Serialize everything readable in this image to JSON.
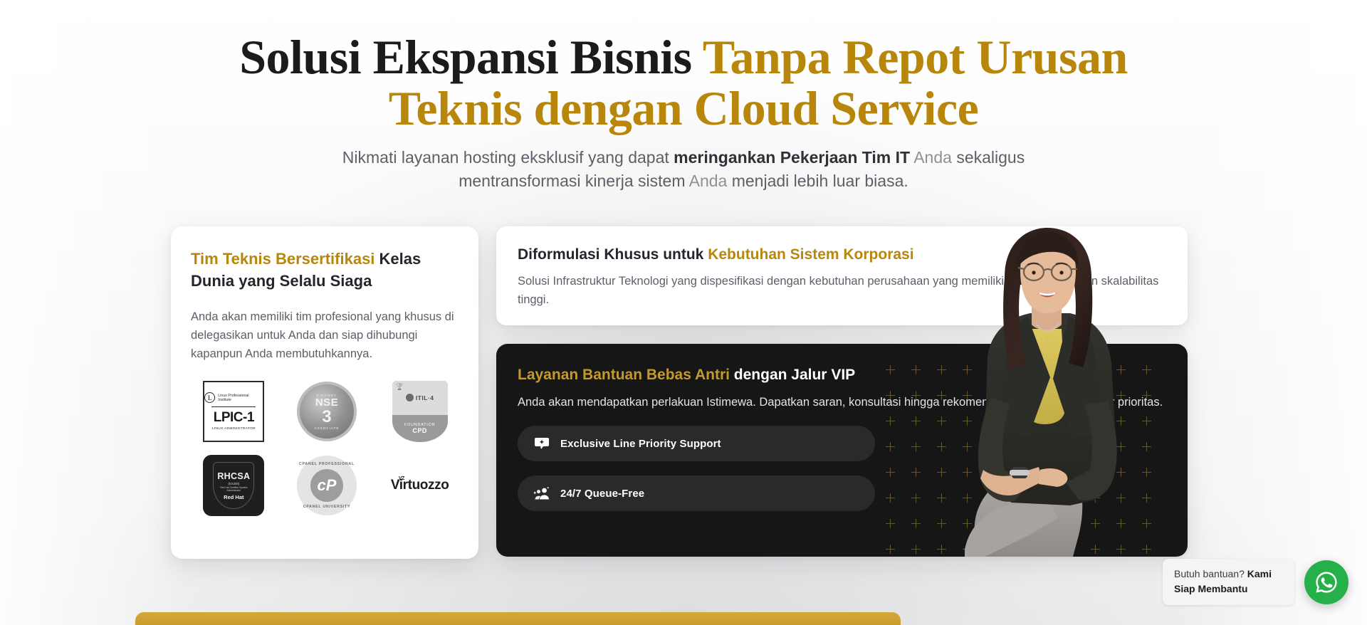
{
  "hero": {
    "headline_part1": "Solusi Ekspansi Bisnis ",
    "headline_part2": "Tanpa Repot Urusan Teknis dengan Cloud Service",
    "sub_1a": "Nikmati layanan hosting eksklusif yang dapat ",
    "sub_1b": "meringankan Pekerjaan Tim IT",
    "sub_1c": " Anda",
    "sub_1d": " sekaligus",
    "sub_2a": "mentransformasi kinerja sistem ",
    "sub_2b": "Anda",
    "sub_2c": " menjadi lebih luar biasa."
  },
  "left_card": {
    "title_gold": "Tim Teknis Bersertifikasi",
    "title_dark": " Kelas Dunia yang Selalu Siaga",
    "body": "Anda akan memiliki tim profesional yang khusus di delegasikan untuk Anda dan siap dihubungi kapanpun Anda membutuhkannya.",
    "badges": [
      {
        "name": "lpic-1",
        "org": "Linux Professional Institute",
        "title": "LPIC-1",
        "subtitle": "LINUX ADMINISTRATOR"
      },
      {
        "name": "fortinet-nse-3",
        "brand": "F RTINET",
        "title": "NSE",
        "level": "3",
        "subtitle": "ASSOCIATE"
      },
      {
        "name": "itil-4-foundation",
        "title": "ITIL·4",
        "tier": "FOUNDATION",
        "subtitle": "CPD"
      },
      {
        "name": "rhcsa-red-hat",
        "title": "RHCSA",
        "code": "(EX200)",
        "desc": "Red Hat Certified System Administrator",
        "brand": "Red Hat"
      },
      {
        "name": "cpanel-professional",
        "arc_top": "CPANEL PROFESSIONAL",
        "mark": "cP",
        "arc_bottom": "CPANEL UNIVERSITY"
      },
      {
        "name": "virtuozzo",
        "title": "Virtuozzo",
        "sup": "VZ"
      }
    ]
  },
  "right_card": {
    "title_dark": "Diformulasi Khusus untuk ",
    "title_gold": "Kebutuhan Sistem Korporasi",
    "body": "Solusi Infrastruktur Teknologi yang dispesifikasi dengan kebutuhan perusahaan yang memiliki kompleksitas dan skalabilitas tinggi."
  },
  "dark_card": {
    "title_gold": "Layanan Bantuan Bebas Antri",
    "title_white": " dengan Jalur VIP",
    "body": "Anda akan mendapatkan perlakuan Istimewa. Dapatkan saran, konsultasi hingga rekomendasi terbaik melalui jalur prioritas.",
    "pills": [
      {
        "icon": "sparkle-chat-icon",
        "label": "Exclusive Line Priority Support"
      },
      {
        "icon": "group-people-icon",
        "label": "24/7 Queue-Free"
      }
    ]
  },
  "whatsapp": {
    "text_normal": "Butuh bantuan? ",
    "text_bold": "Kami Siap Membantu",
    "icon": "whatsapp-icon"
  },
  "colors": {
    "gold": "#b8860b",
    "gold_light": "#c39a2c",
    "dark": "#161616",
    "text_muted": "#5c6069",
    "whatsapp_green": "#25b04a",
    "banner_gold": "#c99c2b"
  }
}
